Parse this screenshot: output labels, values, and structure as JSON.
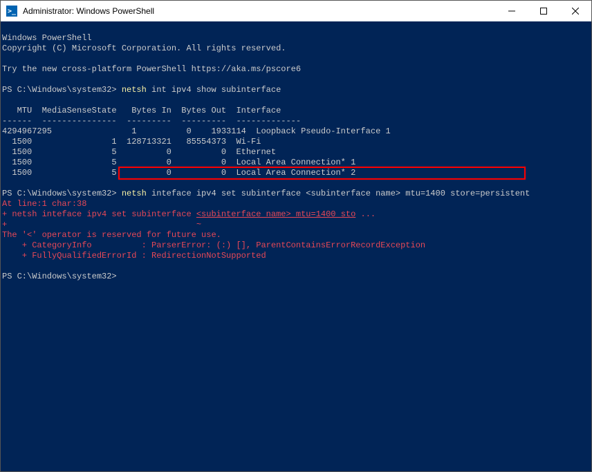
{
  "titlebar": {
    "icon_glyph": ">_",
    "title": "Administrator: Windows PowerShell"
  },
  "header": {
    "line1": "Windows PowerShell",
    "line2": "Copyright (C) Microsoft Corporation. All rights reserved.",
    "blank": "",
    "try_msg": "Try the new cross-platform PowerShell https://aka.ms/pscore6"
  },
  "prompt": {
    "p1": "PS C:\\Windows\\system32> ",
    "p2": "PS C:\\Windows\\system32> ",
    "p3": "PS C:\\Windows\\system32> "
  },
  "cmd1": {
    "netsh": "netsh",
    "rest": " int ipv4 show subinterface"
  },
  "table": {
    "header": "   MTU  MediaSenseState   Bytes In  Bytes Out  Interface",
    "divider": "------  ---------------  ---------  ---------  -------------",
    "rows": [
      "4294967295                1          0    1933114  Loopback Pseudo-Interface 1",
      "  1500                1  128713321   85554373  Wi-Fi",
      "  1500                5          0          0  Ethernet",
      "  1500                5          0          0  Local Area Connection* 1",
      "  1500                5          0          0  Local Area Connection* 2"
    ]
  },
  "cmd2": {
    "netsh": "netsh",
    "rest": " inteface ipv4 set subinterface <subinterface name> mtu=1400 store=persistent"
  },
  "error": {
    "line1": "At line:1 char:38",
    "line2a": "+ netsh inteface ipv4 set subinterface ",
    "line2b": "<subinterface name> mtu=1400 sto",
    "line2c": " ...",
    "line3a": "+                                      ",
    "line3b": "~",
    "line4": "The '<' operator is reserved for future use.",
    "line5": "    + CategoryInfo          : ParserError: (:) [], ParentContainsErrorRecordException",
    "line6": "    + FullyQualifiedErrorId : RedirectionNotSupported"
  }
}
